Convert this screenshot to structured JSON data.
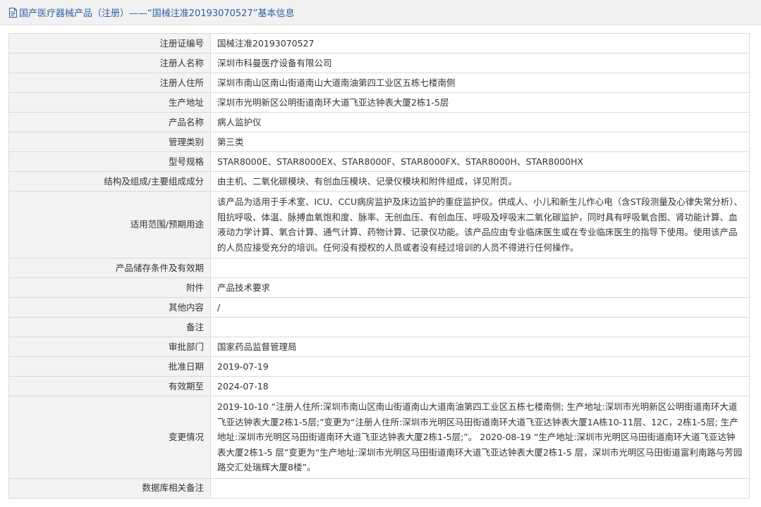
{
  "header": {
    "icon": "document-icon",
    "title": "国产医疗器械产品（注册）——“国械注准20193070527”基本信息"
  },
  "colors": {
    "header_text": "#2a62a8",
    "header_bg": "#f1f1f1",
    "label_bg": "#f3f3f3",
    "border": "#d9d9d9"
  },
  "rows": [
    {
      "label": "注册证编号",
      "value": "国械注准20193070527"
    },
    {
      "label": "注册人名称",
      "value": "深圳市科曼医疗设备有限公司"
    },
    {
      "label": "注册人住所",
      "value": "深圳市南山区南山街道南山大道南油第四工业区五栋七楼南侧"
    },
    {
      "label": "生产地址",
      "value": "深圳市光明新区公明街道南环大道飞亚达钟表大厦2栋1-5层"
    },
    {
      "label": "产品名称",
      "value": "病人监护仪"
    },
    {
      "label": "管理类别",
      "value": "第三类"
    },
    {
      "label": "型号规格",
      "value": "STAR8000E、STAR8000EX、STAR8000F、STAR8000FX、STAR8000H、STAR8000HX"
    },
    {
      "label": "结构及组成/主要组成成分",
      "value": "由主机、二氧化碳模块、有创血压模块、记录仪模块和附件组成，详见附页。"
    },
    {
      "label": "适用范围/预期用途",
      "value": "该产品为适用于手术室、ICU、CCU病房监护及床边监护的重症监护仪。供成人、小儿和新生儿作心电（含ST段测量及心律失常分析）、阻抗呼吸、体温、脉搏血氧饱和度、脉率、无创血压、有创血压、呼吸及呼吸末二氧化碳监护，同时具有呼吸氧合图、肾功能计算、血液动力学计算、氧合计算、通气计算、药物计算、记录仪功能。该产品应由专业临床医生或在专业临床医生的指导下使用。使用该产品的人员应接受充分的培训。任何没有授权的人员或者没有经过培训的人员不得进行任何操作。"
    },
    {
      "label": "产品储存条件及有效期",
      "value": ""
    },
    {
      "label": "附件",
      "value": "产品技术要求"
    },
    {
      "label": "其他内容",
      "value": "/"
    },
    {
      "label": "备注",
      "value": ""
    },
    {
      "label": "审批部门",
      "value": "国家药品监督管理局"
    },
    {
      "label": "批准日期",
      "value": "2019-07-19"
    },
    {
      "label": "有效期至",
      "value": "2024-07-18"
    },
    {
      "label": "变更情况",
      "value": "2019-10-10 “注册人住所:深圳市南山区南山街道南山大道南油第四工业区五栋七楼南侧; 生产地址:深圳市光明新区公明街道南环大道飞亚达钟表大厦2栋1-5层;”变更为“注册人住所:深圳市光明区马田街道南环大道飞亚达钟表大厦1A栋10-11层、12C，2栋1-5层; 生产地址:深圳市光明区马田街道南环大道飞亚达钟表大厦2栋1-5层;”。 2020-08-19 “生产地址:深圳市光明区马田街道南环大道飞亚达钟表大厦2栋1-5 层”变更为“生产地址:深圳市光明区马田街道南环大道飞亚达钟表大厦2栋1-5 层，深圳市光明区马田街道富利南路与芳园路交汇处瑞辉大厦8楼”。"
    },
    {
      "label": "数据库相关备注",
      "value": ""
    }
  ]
}
